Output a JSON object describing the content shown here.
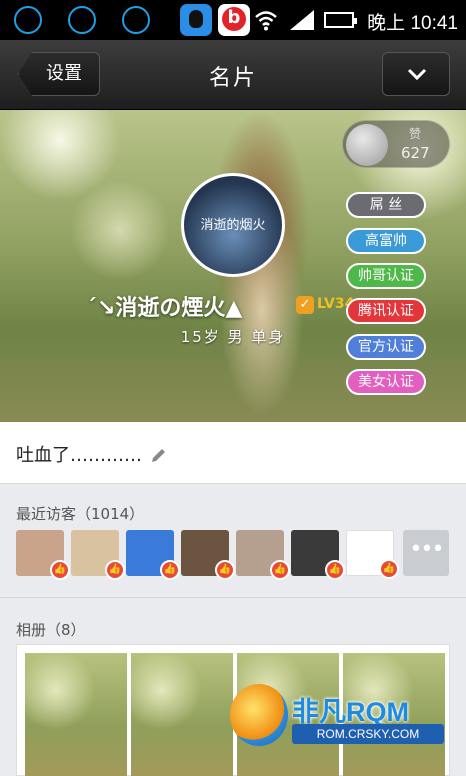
{
  "status_bar": {
    "time": "晚上 10:41"
  },
  "header": {
    "back_label": "设置",
    "title": "名片"
  },
  "profile": {
    "like_label": "赞",
    "like_count": "627",
    "avatar_text": "消逝的烟火",
    "nickname": "ˊ↘消逝の煙火▲",
    "level": "LV34",
    "info": "15岁 男 单身",
    "tags": [
      {
        "label": "屌 丝",
        "color": "#6b6b72"
      },
      {
        "label": "高富帅",
        "color": "#3a9ad8"
      },
      {
        "label": "帅哥认证",
        "color": "#4fb84a"
      },
      {
        "label": "腾讯认证",
        "color": "#e3363a"
      },
      {
        "label": "官方认证",
        "color": "#4f7fd8"
      },
      {
        "label": "美女认证",
        "color": "#e25fc0"
      }
    ]
  },
  "signature": "吐血了…………",
  "visitors": {
    "label": "最近访客（1014）",
    "items": [
      {
        "icon": "visitor-avatar",
        "color": "#c9a48a"
      },
      {
        "icon": "visitor-avatar",
        "color": "#d8c2a0"
      },
      {
        "icon": "visitor-avatar",
        "color": "#3a7ad8"
      },
      {
        "icon": "visitor-avatar",
        "color": "#6b5540"
      },
      {
        "icon": "visitor-avatar",
        "color": "#b5a090"
      },
      {
        "icon": "visitor-avatar",
        "color": "#3a3a3a"
      },
      {
        "icon": "visitor-avatar",
        "color": "#ffffff"
      }
    ],
    "more": "•••"
  },
  "album": {
    "label": "相册（8）"
  },
  "watermark": {
    "title": "非凡RQM",
    "url": "ROM.CRSKY.COM"
  }
}
